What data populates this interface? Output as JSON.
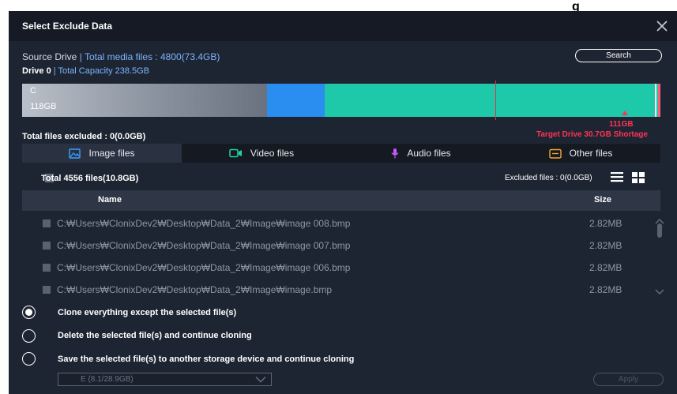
{
  "background_fragment": "g",
  "dialog": {
    "title": "Select Exclude Data",
    "source_label": "Source Drive",
    "source_sep": "|",
    "total_media": "Total media files : 4800(73.4GB)",
    "drive_label": "Drive 0",
    "drive_sep": "|",
    "total_capacity": "Total Capacity 238.5GB",
    "search_label": "Search"
  },
  "usage_bar": {
    "partition_label": "C",
    "partition_size": "118GB",
    "marker_size": "111GB",
    "target_text": "Target Drive 30.7GB Shortage",
    "colors": {
      "partition": "#8a929f",
      "blue": "#2a8ef0",
      "teal": "#1ec9a9",
      "shortage": "#ff3355"
    }
  },
  "excluded_total": "Total files excluded : 0(0.0GB)",
  "tabs": [
    {
      "label": "Image files",
      "icon": "image-icon",
      "active": true
    },
    {
      "label": "Video files",
      "icon": "video-icon",
      "active": false
    },
    {
      "label": "Audio files",
      "icon": "microphone-icon",
      "active": false
    },
    {
      "label": "Other files",
      "icon": "folder-icon",
      "active": false
    }
  ],
  "toolbar": {
    "total_label": "Total 4556 files(10.8GB)",
    "excluded_label": "Excluded files : 0(0.0GB)"
  },
  "table": {
    "columns": {
      "name": "Name",
      "size": "Size"
    },
    "rows": [
      {
        "name": "C:₩Users₩ClonixDev2₩Desktop₩Data_2₩Image₩image 008.bmp",
        "size": "2.82MB"
      },
      {
        "name": "C:₩Users₩ClonixDev2₩Desktop₩Data_2₩Image₩image 007.bmp",
        "size": "2.82MB"
      },
      {
        "name": "C:₩Users₩ClonixDev2₩Desktop₩Data_2₩Image₩image 006.bmp",
        "size": "2.82MB"
      },
      {
        "name": "C:₩Users₩ClonixDev2₩Desktop₩Data_2₩Image₩image.bmp",
        "size": "2.82MB"
      }
    ]
  },
  "options": [
    {
      "label": "Clone everything except the selected file(s)",
      "selected": true
    },
    {
      "label": "Delete the selected file(s) and continue cloning",
      "selected": false
    },
    {
      "label": "Save the selected file(s) to another storage device and continue cloning",
      "selected": false
    }
  ],
  "storage_select": {
    "value": "E (8.1/28.9GB)"
  },
  "apply_label": "Apply"
}
